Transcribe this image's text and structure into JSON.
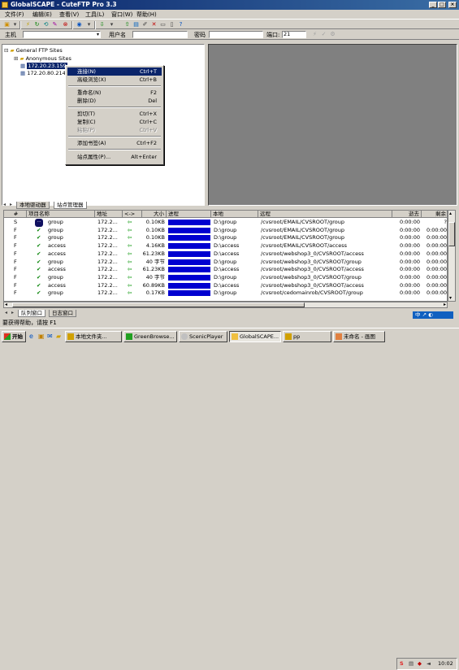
{
  "window": {
    "title": "GlobalSCAPE - CuteFTP Pro 3.3",
    "minimize": "_",
    "maximize": "□",
    "close": "×"
  },
  "menu": [
    "文件(F)",
    "编辑(E)",
    "查看(V)",
    "工具(L)",
    "窗口(W)",
    "帮助(H)"
  ],
  "connect_bar": {
    "host_label": "主机",
    "user_label": "用户名",
    "password_label": "密码",
    "port_label": "端口:",
    "port_value": "21"
  },
  "tree": {
    "root": "General FTP Sites",
    "anon": "Anonymous Sites",
    "site1": "172.20.23.159",
    "site2": "172.20.80.214"
  },
  "left_tabs": [
    "本地驱动器",
    "站点管理器"
  ],
  "context_menu": [
    {
      "label": "连接(N)",
      "key": "Ctrl+T",
      "state": "highlight"
    },
    {
      "label": "高级浏览(X)",
      "key": "Ctrl+B",
      "state": "normal"
    },
    {
      "sep": true
    },
    {
      "label": "重命名(N)",
      "key": "F2",
      "state": "normal"
    },
    {
      "label": "删除(D)",
      "key": "Del",
      "state": "normal"
    },
    {
      "sep": true
    },
    {
      "label": "剪切(T)",
      "key": "Ctrl+X",
      "state": "normal"
    },
    {
      "label": "复制(C)",
      "key": "Ctrl+C",
      "state": "normal"
    },
    {
      "label": "粘贴(P)",
      "key": "Ctrl+V",
      "state": "disabled"
    },
    {
      "sep": true
    },
    {
      "label": "添加书签(A)",
      "key": "Ctrl+F2",
      "state": "normal"
    },
    {
      "sep": true
    },
    {
      "label": "站点属性(P)...",
      "key": "Alt+Enter",
      "state": "normal"
    }
  ],
  "queue": {
    "columns": [
      "#",
      "项目名称",
      "地址",
      "<->",
      "大小",
      "进程",
      "本地",
      "远程",
      "逝去",
      "剩余"
    ],
    "rows": [
      {
        "n": "S",
        "name": "group",
        "addr": "172.2...",
        "size": "0.10KB",
        "local": "D:\\group",
        "remote": "/cvsroot/EMAIL/CVSROOT/group",
        "elapsed": "0:00:00",
        "left": "?"
      },
      {
        "n": "F",
        "name": "group",
        "addr": "172.2...",
        "size": "0.10KB",
        "local": "D:\\group",
        "remote": "/cvsroot/EMAIL/CVSROOT/group",
        "elapsed": "0:00:00",
        "left": "0:00:00"
      },
      {
        "n": "F",
        "name": "group",
        "addr": "172.2...",
        "size": "0.10KB",
        "local": "D:\\group",
        "remote": "/cvsroot/EMAIL/CVSROOT/group",
        "elapsed": "0:00:00",
        "left": "0:00:00"
      },
      {
        "n": "F",
        "name": "access",
        "addr": "172.2...",
        "size": "4.16KB",
        "local": "D:\\access",
        "remote": "/cvsroot/EMAIL/CVSROOT/access",
        "elapsed": "0:00:00",
        "left": "0:00:00"
      },
      {
        "n": "F",
        "name": "access",
        "addr": "172.2...",
        "size": "61.23KB",
        "local": "D:\\access",
        "remote": "/cvsroot/webshop3_0/CVSROOT/access",
        "elapsed": "0:00:00",
        "left": "0:00:00"
      },
      {
        "n": "F",
        "name": "group",
        "addr": "172.2...",
        "size": "40 字节",
        "local": "D:\\group",
        "remote": "/cvsroot/webshop3_0/CVSROOT/group",
        "elapsed": "0:00:00",
        "left": "0:00:00"
      },
      {
        "n": "F",
        "name": "access",
        "addr": "172.2...",
        "size": "61.23KB",
        "local": "D:\\access",
        "remote": "/cvsroot/webshop3_0/CVSROOT/access",
        "elapsed": "0:00:00",
        "left": "0:00:00"
      },
      {
        "n": "F",
        "name": "group",
        "addr": "172.2...",
        "size": "40 字节",
        "local": "D:\\group",
        "remote": "/cvsroot/webshop3_0/CVSROOT/group",
        "elapsed": "0:00:00",
        "left": "0:00:00"
      },
      {
        "n": "F",
        "name": "access",
        "addr": "172.2...",
        "size": "60.89KB",
        "local": "D:\\access",
        "remote": "/cvsroot/webshop3_0/CVSROOT/access",
        "elapsed": "0:00:00",
        "left": "0:00:00"
      },
      {
        "n": "F",
        "name": "group",
        "addr": "172.2...",
        "size": "0.17KB",
        "local": "D:\\group",
        "remote": "/cvsroot/cedomainrob/CVSROOT/group",
        "elapsed": "0:00:00",
        "left": "0:00:00"
      }
    ]
  },
  "bottom_tabs": [
    "队列窗口",
    "日志窗口"
  ],
  "status": "要获得帮助，请按 F1",
  "taskbar": {
    "start": "开始",
    "tasks": [
      "本地文件夹...",
      "GreenBrowse...",
      "ScenicPlayer",
      "GlobalSCAPE...",
      "pp",
      "未命名 - 画图"
    ],
    "clock": "10:02"
  },
  "ime": "中 ↗ ◐",
  "colors": {
    "title_start": "#0a246a",
    "progress": "#0000d0",
    "highlight": "#0a246a"
  }
}
